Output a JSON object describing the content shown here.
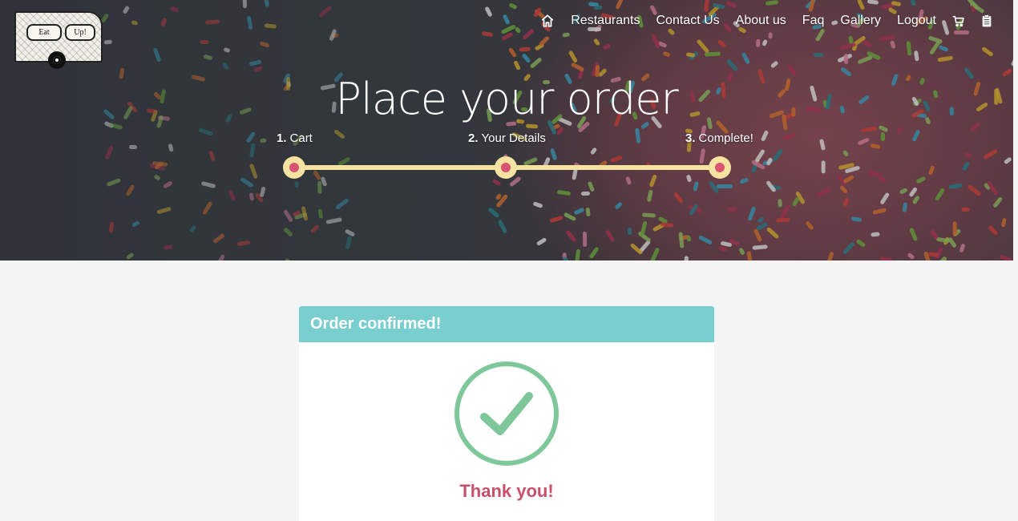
{
  "logo": {
    "word1": "Eat",
    "word2": "Up!"
  },
  "nav": {
    "home_icon": "home-icon",
    "items": [
      {
        "label": "Restaurants"
      },
      {
        "label": "Contact Us"
      },
      {
        "label": "About us"
      },
      {
        "label": "Faq"
      },
      {
        "label": "Gallery"
      },
      {
        "label": "Logout"
      }
    ],
    "cart_icon": "cart-icon",
    "orders_icon": "clipboard-icon"
  },
  "hero": {
    "title": "Place your order",
    "steps": [
      {
        "number": "1.",
        "label": "Cart"
      },
      {
        "number": "2.",
        "label": "Your Details"
      },
      {
        "number": "3.",
        "label": "Complete!"
      }
    ]
  },
  "card": {
    "header": "Order confirmed!",
    "icon": "checkmark-circle-icon",
    "message": "Thank you!"
  },
  "colors": {
    "accent_teal": "#79cfcf",
    "success_green": "#7ec79a",
    "thank_you_pink": "#c9506a",
    "progress_cream": "#f7e3a1",
    "progress_dot": "#d9546e"
  }
}
